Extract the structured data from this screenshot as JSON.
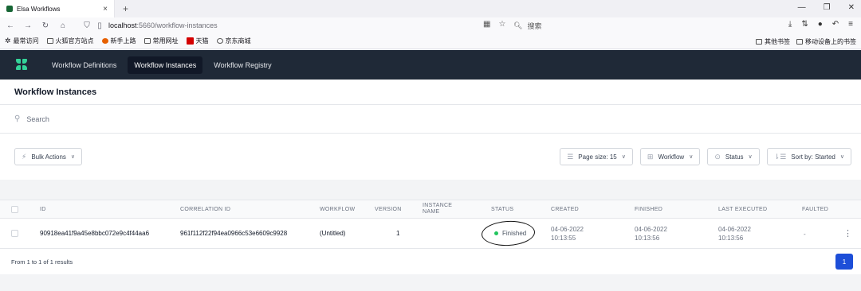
{
  "browser": {
    "tab_title": "Elsa Workflows",
    "tab_close": "×",
    "new_tab": "+",
    "url_host": "localhost",
    "url_path": ":5660/workflow-instances",
    "search_placeholder": "搜索",
    "bookmarks": [
      "最常访问",
      "火狐官方站点",
      "新手上路",
      "常用网址",
      "天猫",
      "京东商城"
    ],
    "bookmarks_right": [
      "其他书签",
      "移动设备上的书签"
    ]
  },
  "app": {
    "nav": [
      {
        "label": "Workflow Definitions"
      },
      {
        "label": "Workflow Instances"
      },
      {
        "label": "Workflow Registry"
      }
    ],
    "brand_color": "#34d399"
  },
  "page": {
    "title": "Workflow Instances",
    "search_placeholder": "Search",
    "bulk_actions": "Bulk Actions",
    "page_size": "Page size: 15",
    "workflow_filter": "Workflow",
    "status_filter": "Status",
    "sort_by": "Sort by: Started"
  },
  "table": {
    "headers": {
      "id": "ID",
      "correlation_id": "CORRELATION ID",
      "workflow": "WORKFLOW",
      "version": "VERSION",
      "instance_name": "INSTANCE NAME",
      "status": "STATUS",
      "created": "CREATED",
      "finished": "FINISHED",
      "last_executed": "LAST EXECUTED",
      "faulted": "FAULTED"
    },
    "rows": [
      {
        "id": "90918ea41f9a45e8bbc072e9c4f44aa6",
        "correlation_id": "961f112f22f94ea0966c53e6609c9928",
        "workflow": "(Untitled)",
        "version": "1",
        "instance_name": "",
        "status": "Finished",
        "status_color": "#22c55e",
        "created_date": "04-06-2022",
        "created_time": "10:13:55",
        "finished_date": "04-06-2022",
        "finished_time": "10:13:56",
        "last_executed_date": "04-06-2022",
        "last_executed_time": "10:13:56",
        "faulted": "-"
      }
    ]
  },
  "pagination": {
    "summary": "From 1 to 1 of 1 results",
    "current_page": "1",
    "accent": "#1d4ed8"
  }
}
